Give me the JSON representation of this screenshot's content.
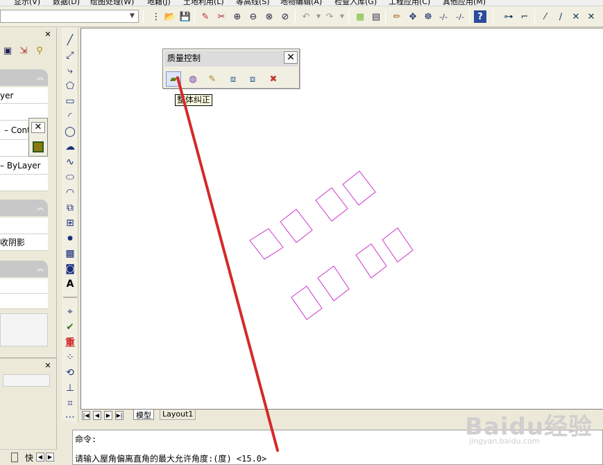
{
  "menu": {
    "items": [
      "显示(V)",
      "数据(D)",
      "绘图处理(W)",
      "地籍(J)",
      "土地利用(L)",
      "等高线(S)",
      "地物编辑(A)",
      "检查入库(G)",
      "工程应用(C)",
      "其他应用(M)"
    ]
  },
  "toolbar": {
    "icons": [
      "open-icon",
      "save-icon",
      "pencil-icon",
      "match-icon",
      "zoom-realtime-icon",
      "zoom-window-icon",
      "zoom-extents-icon",
      "zoom-previous-icon",
      "undo-icon",
      "redo-icon",
      "properties-icon",
      "calculator-icon",
      "edit-icon",
      "move-icon",
      "pan-icon",
      "dashed-line-icon",
      "dashed-line-2-icon",
      "help-icon",
      "connect-icon",
      "corner-icon",
      "line-icon",
      "line-2-icon",
      "cross-icon",
      "cross-2-icon"
    ]
  },
  "left_panel": {
    "rows": [
      "yer",
      "– Conti",
      "– ByLayer",
      "收阴影"
    ]
  },
  "quality_toolbar": {
    "title": "质量控制",
    "tooltip": "整体纠正",
    "close_label": "✕"
  },
  "small_toolbar": {
    "close_label": "✕"
  },
  "tabs": [
    "模型",
    "Layout1"
  ],
  "command": {
    "line1": "命令:",
    "line2": "请输入屋角偏离直角的最大允许角度:(度) <15.0>"
  },
  "status": {
    "label": "快"
  },
  "watermark": {
    "text": "Baidu经验",
    "url": "jingyan.baidu.com"
  },
  "colors": {
    "building_outline": "#cc33cc",
    "annotation_line": "#d42a2a"
  }
}
